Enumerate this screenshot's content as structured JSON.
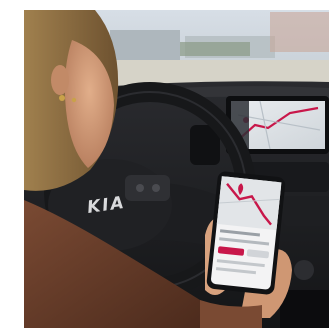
{
  "photo": {
    "steering_wheel_logo": "KIA",
    "infotainment_screen": {
      "content": "map-navigation"
    },
    "phone_screen": {
      "content": "map-route-app"
    }
  },
  "colors": {
    "background": "#ffffff",
    "sky": "#cfd9e2",
    "dashboard": "#1b1c1f",
    "hair": "#8a6a3e",
    "skin": "#d8a27e",
    "jacket": "#6a3e2a",
    "route_accent": "#c8174a"
  }
}
